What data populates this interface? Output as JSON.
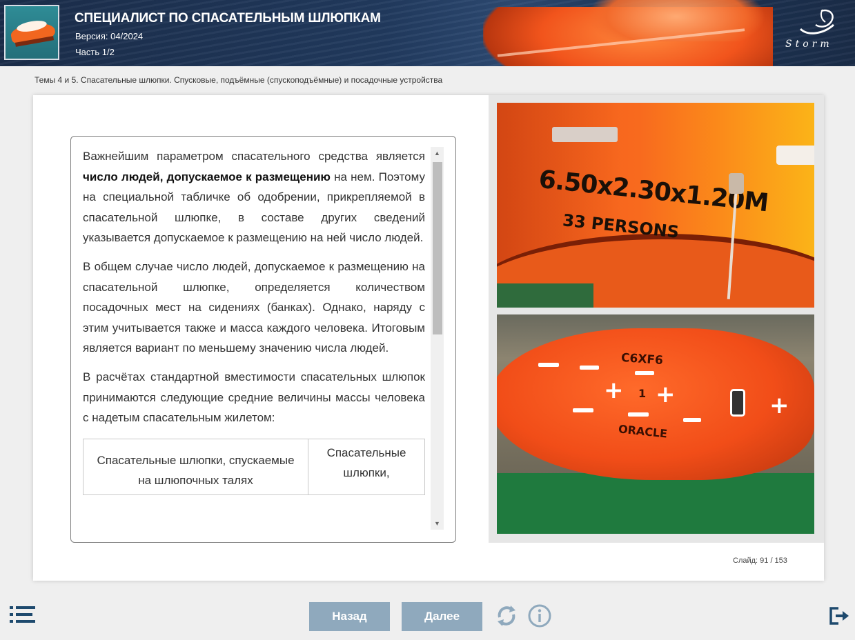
{
  "header": {
    "title": "СПЕЦИАЛИСТ ПО СПАСАТЕЛЬНЫМ ШЛЮПКАМ",
    "version": "Версия: 04/2024",
    "part": "Часть 1/2",
    "logo_text": "Storm"
  },
  "breadcrumb": "Темы 4 и 5. Спасательные шлюпки. Спусковые, подъёмные (спускоподъёмные) и посадочные устройства",
  "content": {
    "p1_before": "Важнейшим параметром спасательного средства является ",
    "p1_bold": "число людей, допускаемое к размещению",
    "p1_after": " на нем. Поэтому на специальной табличке об одобрении, прикрепляемой в спасательной шлюпке, в составе других сведений указывается допускаемое к размещению на ней число людей.",
    "p2": "В общем случае число людей, допускаемое к размещению на спасательной шлюпке, определяется количеством посадочных мест на сидениях (банках). Однако, наряду с этим учитывается также и масса каждого человека. Итоговым является вариант по меньшему значению числа людей.",
    "p3": "В расчётах стандартной вместимости спасательных шлюпок принимаются следующие средние величины массы человека с надетым спасательным жилетом:",
    "table": {
      "col1": "Спасательные шлюпки, спускаемые на шлюпочных талях",
      "col2": "Спасательные шлюпки,"
    }
  },
  "photos": {
    "photo1_text_line1": "6.50x2.30x1.20M",
    "photo1_text_line2": "33 PERSONS",
    "photo2_callsign": "C6XF6",
    "photo2_number": "1",
    "photo2_name": "ORACLE"
  },
  "slide": "Слайд:  91 / 153",
  "nav": {
    "back_label": "Назад",
    "next_label": "Далее"
  },
  "colors": {
    "header_bg": "#1e3556",
    "button_bg": "#8fa9bd",
    "icon_color": "#1e4a6e",
    "boat_orange": "#f1541c"
  },
  "icons": [
    "menu-icon",
    "reload-icon",
    "info-icon",
    "exit-icon"
  ]
}
